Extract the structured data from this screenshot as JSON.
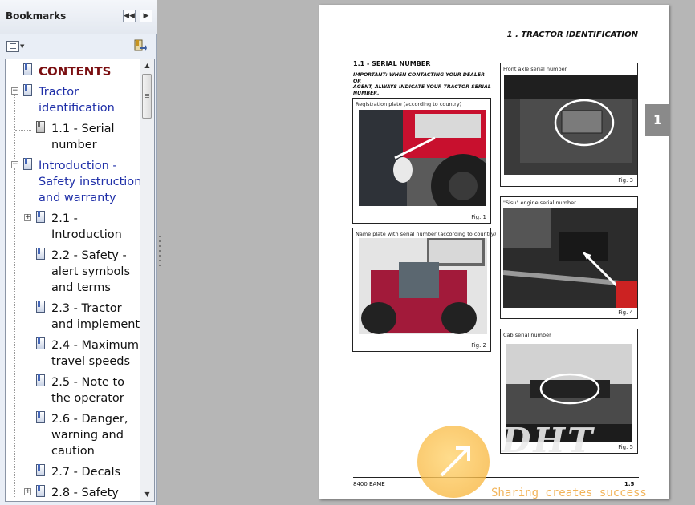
{
  "panel": {
    "title": "Bookmarks",
    "bookmarks": [
      {
        "label": "CONTENTS"
      },
      {
        "label_lines": [
          "Tractor",
          "identification"
        ]
      },
      {
        "label_lines": [
          "1.1 - Serial",
          "number"
        ]
      },
      {
        "label_lines": [
          "Introduction -",
          "Safety instructions",
          "and warranty"
        ]
      },
      {
        "label_lines": [
          "2.1 -",
          "Introduction"
        ]
      },
      {
        "label_lines": [
          "2.2 - Safety -",
          "alert symbols",
          "and terms"
        ]
      },
      {
        "label_lines": [
          "2.3 - Tractor",
          "and implements"
        ]
      },
      {
        "label_lines": [
          "2.4 - Maximum",
          "travel speeds"
        ]
      },
      {
        "label_lines": [
          "2.5 - Note to",
          "the operator"
        ]
      },
      {
        "label_lines": [
          "2.6 - Danger,",
          "warning and",
          "caution"
        ]
      },
      {
        "label_lines": [
          "2.7 - Decals"
        ]
      },
      {
        "label_lines": [
          "2.8 - Safety"
        ]
      }
    ]
  },
  "document": {
    "running_title": "1 . TRACTOR IDENTIFICATION",
    "section_title": "1.1 -  SERIAL NUMBER",
    "important_note_lines": [
      "IMPORTANT: WHEN CONTACTING YOUR DEALER OR",
      "AGENT, ALWAYS INDICATE YOUR TRACTOR SERIAL",
      "NUMBER."
    ],
    "figures": [
      {
        "caption": "Registration plate (according to country)",
        "number": "Fig. 1"
      },
      {
        "caption": "Name plate with serial number (according to country)",
        "number": "Fig. 2"
      },
      {
        "caption": "Front axle serial number",
        "number": "Fig. 3"
      },
      {
        "caption": "\"Sisu\" engine serial number",
        "number": "Fig. 4"
      },
      {
        "caption": "Cab serial number",
        "number": "Fig. 5"
      }
    ],
    "footer_left": "8400 EAME",
    "footer_right": "1.5",
    "chapter_tab": "1"
  },
  "watermark": {
    "slogan": "Sharing creates success"
  }
}
